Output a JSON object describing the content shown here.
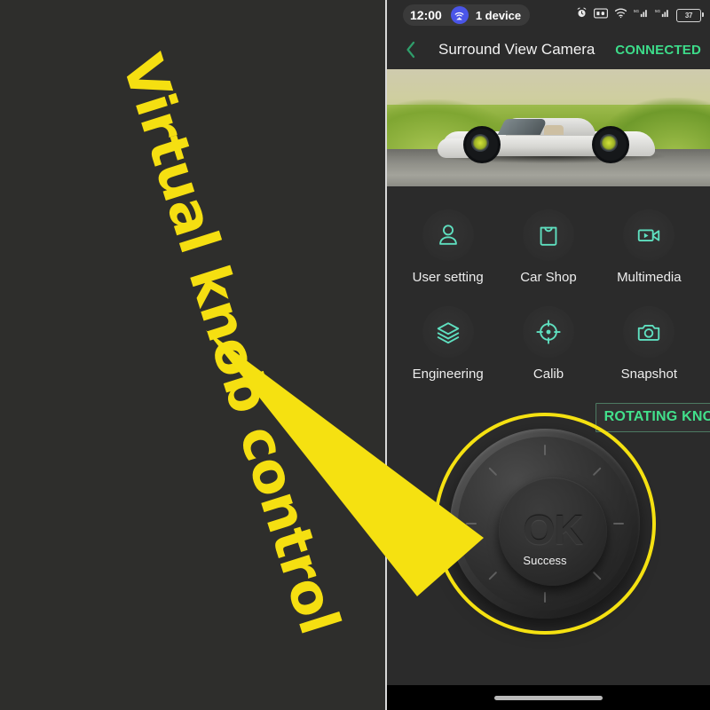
{
  "annotation": {
    "callout_text": "Virtual knob control",
    "callout_color": "#f5df11",
    "highlight_ring_color": "#f5e111"
  },
  "phone": {
    "status_bar": {
      "clock": "12:00",
      "tether_icon": "wifi-tether-icon",
      "device_count": "1 device",
      "icons": [
        "alarm-icon",
        "hd-icon",
        "wifi-icon",
        "signal-sim1-icon",
        "signal-sim2-icon"
      ],
      "battery_level": "37"
    },
    "header": {
      "back_icon": "chevron-left-icon",
      "title": "Surround View Camera",
      "connection_status": "CONNECTED",
      "connection_color": "#3ddc8a"
    },
    "hero": {
      "alt": "white convertible sports car on road with green grass"
    },
    "function_grid": [
      {
        "label": "User setting",
        "icon": "user-icon"
      },
      {
        "label": "Car Shop",
        "icon": "shopping-bag-icon"
      },
      {
        "label": "Multimedia",
        "icon": "video-camera-icon"
      },
      {
        "label": "Engineering",
        "icon": "layers-icon"
      },
      {
        "label": "Calib",
        "icon": "crosshair-target-icon"
      },
      {
        "label": "Snapshot",
        "icon": "camera-icon"
      }
    ],
    "icon_accent_color": "#5fe0c0",
    "rotating_knob_chip": {
      "label": "ROTATING KNOB",
      "color": "#42e08b",
      "border_color": "#4d7a62"
    },
    "knob": {
      "center_label": "OK",
      "status_label": "Success",
      "tick_count": 8
    },
    "nav_bar": {
      "home_indicator": "home-indicator"
    }
  }
}
